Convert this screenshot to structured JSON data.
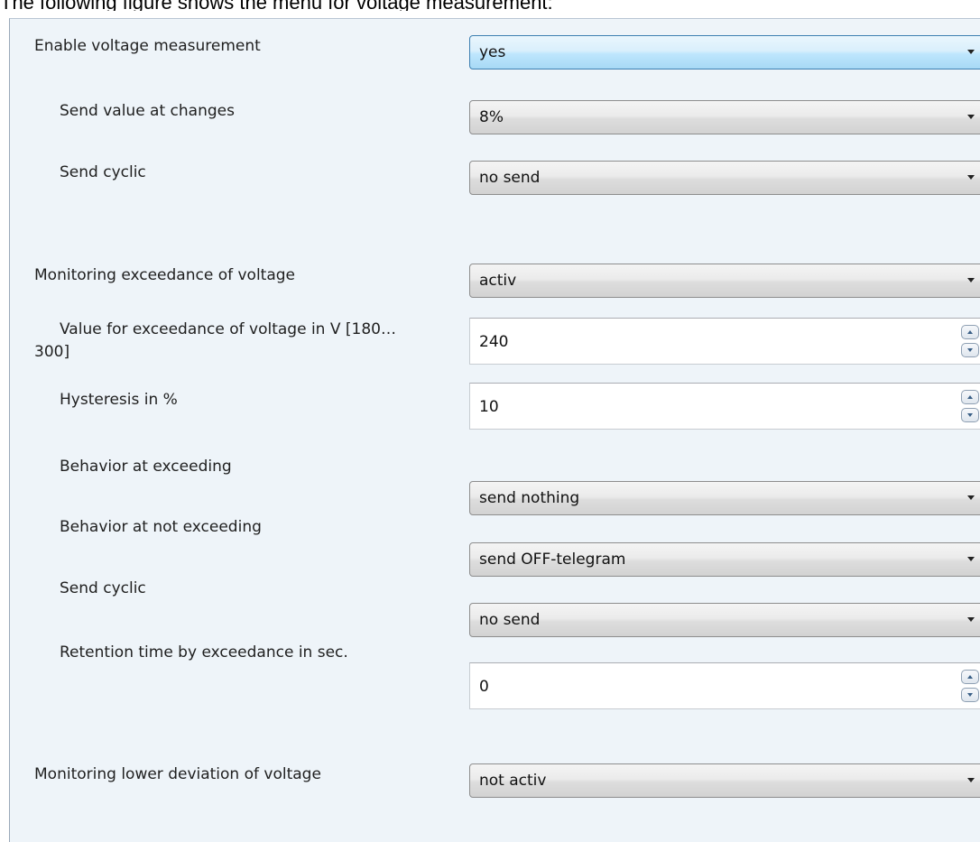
{
  "caption": "The following figure shows the menu for voltage measurement:",
  "rows": [
    {
      "label": "Enable voltage measurement",
      "type": "dropdown",
      "value": "yes",
      "focused": true
    },
    {
      "label": "Send value at changes",
      "type": "dropdown",
      "value": "8%"
    },
    {
      "label": "Send cyclic",
      "type": "dropdown",
      "value": "no send"
    },
    {
      "label": "Monitoring exceedance of voltage",
      "type": "dropdown",
      "value": "activ"
    },
    {
      "label_line1": "Value for exceedance of voltage in V [180…",
      "label_line2": "300]",
      "type": "number",
      "value": "240"
    },
    {
      "label": "Hysteresis in %",
      "type": "number",
      "value": "10"
    },
    {
      "label": "Behavior at exceeding",
      "type": "dropdown",
      "value": "send nothing"
    },
    {
      "label": "Behavior at not exceeding",
      "type": "dropdown",
      "value": "send OFF-telegram"
    },
    {
      "label": "Send cyclic",
      "type": "dropdown",
      "value": "no send"
    },
    {
      "label": "Retention time by exceedance in sec.",
      "type": "number",
      "value": "0"
    },
    {
      "label": "Monitoring lower deviation of voltage",
      "type": "dropdown",
      "value": "not activ"
    }
  ]
}
